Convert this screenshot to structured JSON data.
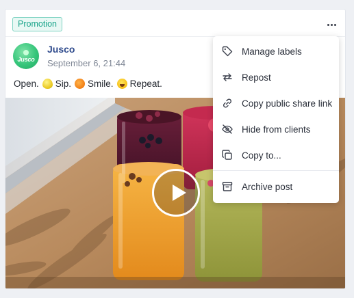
{
  "post": {
    "badge": "Promotion",
    "more_icon": "more-horizontal-icon",
    "author": "Jusco",
    "avatar_text": "Jusco",
    "timestamp": "September 6, 21:44",
    "caption": {
      "part1": "Open.",
      "part2": "Sip.",
      "part3": "Smile.",
      "part4": "Repeat.",
      "emojis": [
        "lemon",
        "tangerine",
        "grinning-face"
      ]
    },
    "media": {
      "type": "video",
      "description_icon": "play-icon"
    }
  },
  "menu": {
    "items": [
      {
        "label": "Manage labels",
        "icon": "tag-icon"
      },
      {
        "label": "Repost",
        "icon": "repost-icon"
      },
      {
        "label": "Copy public share link",
        "icon": "link-icon"
      },
      {
        "label": "Hide from clients",
        "icon": "eye-off-icon"
      },
      {
        "label": "Copy to...",
        "icon": "copy-icon"
      },
      {
        "label": "Archive post",
        "icon": "archive-icon"
      }
    ]
  },
  "colors": {
    "badge_text": "#17a389",
    "badge_border": "#7fd3c3",
    "author": "#2e4a8c",
    "avatar": "#35c57a"
  }
}
